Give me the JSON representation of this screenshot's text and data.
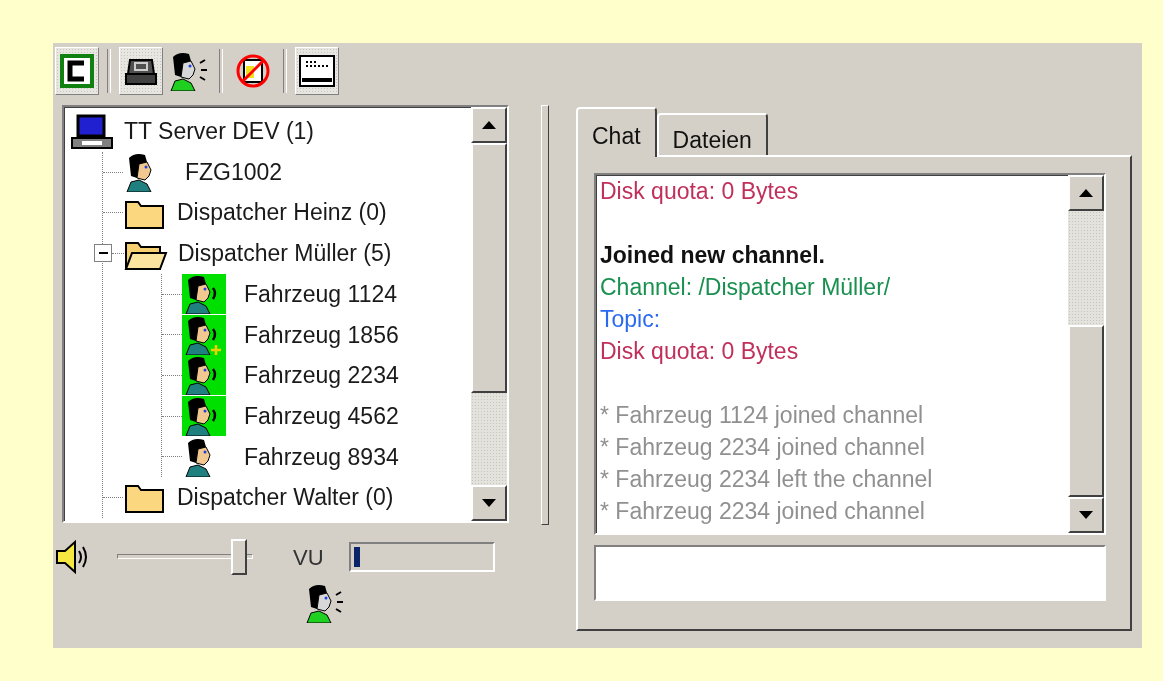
{
  "toolbar": [
    {
      "kind": "connect",
      "checked": true
    },
    {
      "kind": "device",
      "checked": true
    },
    {
      "kind": "talk",
      "checked": false
    },
    {
      "kind": "mute",
      "checked": false
    },
    {
      "kind": "keyboard",
      "checked": true
    }
  ],
  "tree": [
    {
      "kind": "server",
      "label": "TT Server DEV (1)",
      "children": [
        {
          "kind": "user",
          "label": "FZG1002",
          "talking": false,
          "marked": false
        },
        {
          "kind": "folder",
          "label": "Dispatcher Heinz (0)"
        },
        {
          "kind": "folder",
          "label": "Dispatcher Müller (5)",
          "expanded": true,
          "children": [
            {
              "kind": "user",
              "label": "Fahrzeug 1124",
              "talking": true,
              "marked": false
            },
            {
              "kind": "user",
              "label": "Fahrzeug 1856",
              "talking": true,
              "marked": true
            },
            {
              "kind": "user",
              "label": "Fahrzeug 2234",
              "talking": true,
              "marked": false
            },
            {
              "kind": "user",
              "label": "Fahrzeug 4562",
              "talking": true,
              "marked": false
            },
            {
              "kind": "user",
              "label": "Fahrzeug 8934",
              "talking": false,
              "marked": false
            }
          ]
        },
        {
          "kind": "folder",
          "label": "Dispatcher Walter (0)"
        }
      ]
    }
  ],
  "volume": {
    "level": 0.95
  },
  "vu": {
    "label": "VU",
    "level": 0.05
  },
  "tabs": [
    {
      "label": "Chat",
      "selected": true
    },
    {
      "label": "Dateien",
      "selected": false
    }
  ],
  "chat": [
    {
      "kind": "quota",
      "text": "Disk quota: 0 Bytes"
    },
    {
      "kind": "spacer"
    },
    {
      "kind": "notice",
      "text": "Joined new channel."
    },
    {
      "kind": "channel",
      "text": "Channel: /Dispatcher Müller/"
    },
    {
      "kind": "topic",
      "text": "Topic:"
    },
    {
      "kind": "quota",
      "text": "Disk quota: 0 Bytes"
    },
    {
      "kind": "spacer"
    },
    {
      "kind": "event",
      "text": "* Fahrzeug 1124 joined channel"
    },
    {
      "kind": "event",
      "text": "* Fahrzeug 2234 joined channel"
    },
    {
      "kind": "event",
      "text": "* Fahrzeug 2234 left the channel"
    },
    {
      "kind": "event",
      "text": "* Fahrzeug 2234 joined channel"
    }
  ]
}
